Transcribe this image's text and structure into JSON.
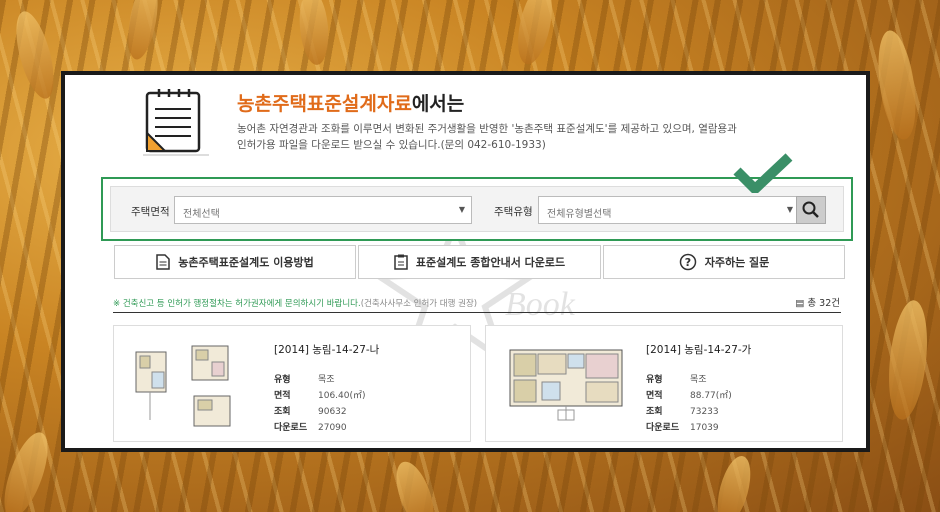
{
  "header": {
    "title_highlight": "농촌주택표준설계자료",
    "title_rest": "에서는",
    "desc_line1": "농어촌 자연경관과 조화를 이루면서 변화된 주거생활을 반영한 '농촌주택 표준설계도'를 제공하고 있으며, 열람용과",
    "desc_line2": "인허가용 파일을 다운로드 받으실 수 있습니다.(문의 042-610-1933)"
  },
  "search": {
    "area_label": "주택면적",
    "area_value": "전체선택",
    "type_label": "주택유형",
    "type_value": "전체유형별선택"
  },
  "buttons": {
    "guide": "농촌주택표준설계도 이용방법",
    "download": "표준설계도 종합안내서 다운로드",
    "faq": "자주하는 질문"
  },
  "notice": {
    "main": "※ 건축신고 등 인허가 행정절차는 허가권자에게 문의하시기 바랍니다.",
    "sub": "(건축사사무소 인허가 대행 권장)"
  },
  "total": "총 32건",
  "labels": {
    "type": "유형",
    "area": "면적",
    "views": "조회",
    "downloads": "다운로드"
  },
  "cards": [
    {
      "title": "[2014] 농림-14-27-나",
      "type": "목조",
      "area": "106.40(㎡)",
      "views": "90632",
      "downloads": "27090"
    },
    {
      "title": "[2014] 농림-14-27-가",
      "type": "목조",
      "area": "88.77(㎡)",
      "views": "73233",
      "downloads": "17039"
    }
  ],
  "watermark": "Book",
  "colors": {
    "accent": "#e06b1a",
    "green": "#2f9a55",
    "check": "#3a8f67"
  }
}
